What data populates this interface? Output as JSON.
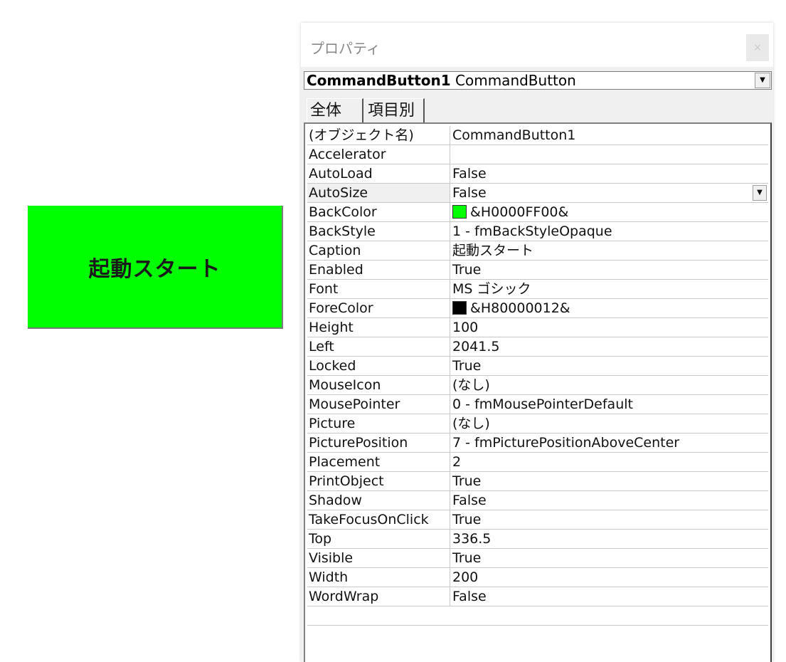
{
  "worksheet": {
    "button_caption": "起動スタート",
    "button_color": "#00ff00"
  },
  "properties_window": {
    "title": "プロパティ",
    "close_label": "×",
    "object_name": "CommandButton1",
    "object_type": "CommandButton",
    "tabs": [
      {
        "label": "全体",
        "active": true
      },
      {
        "label": "項目別",
        "active": false
      }
    ],
    "rows": [
      {
        "name": "(オブジェクト名)",
        "value": "CommandButton1"
      },
      {
        "name": "Accelerator",
        "value": ""
      },
      {
        "name": "AutoLoad",
        "value": "False"
      },
      {
        "name": "AutoSize",
        "value": "False",
        "selected": true
      },
      {
        "name": "BackColor",
        "value": "&H0000FF00&",
        "swatch": "#00ff00"
      },
      {
        "name": "BackStyle",
        "value": "1 - fmBackStyleOpaque"
      },
      {
        "name": "Caption",
        "value": "起動スタート"
      },
      {
        "name": "Enabled",
        "value": "True"
      },
      {
        "name": "Font",
        "value": "MS ゴシック"
      },
      {
        "name": "ForeColor",
        "value": "&H80000012&",
        "swatch": "#000000"
      },
      {
        "name": "Height",
        "value": "100"
      },
      {
        "name": "Left",
        "value": "2041.5"
      },
      {
        "name": "Locked",
        "value": "True"
      },
      {
        "name": "MouseIcon",
        "value": "(なし)"
      },
      {
        "name": "MousePointer",
        "value": "0 - fmMousePointerDefault"
      },
      {
        "name": "Picture",
        "value": "(なし)"
      },
      {
        "name": "PicturePosition",
        "value": "7 - fmPicturePositionAboveCenter"
      },
      {
        "name": "Placement",
        "value": "2"
      },
      {
        "name": "PrintObject",
        "value": "True"
      },
      {
        "name": "Shadow",
        "value": "False"
      },
      {
        "name": "TakeFocusOnClick",
        "value": "True"
      },
      {
        "name": "Top",
        "value": "336.5"
      },
      {
        "name": "Visible",
        "value": "True"
      },
      {
        "name": "Width",
        "value": "200"
      },
      {
        "name": "WordWrap",
        "value": "False"
      }
    ]
  }
}
